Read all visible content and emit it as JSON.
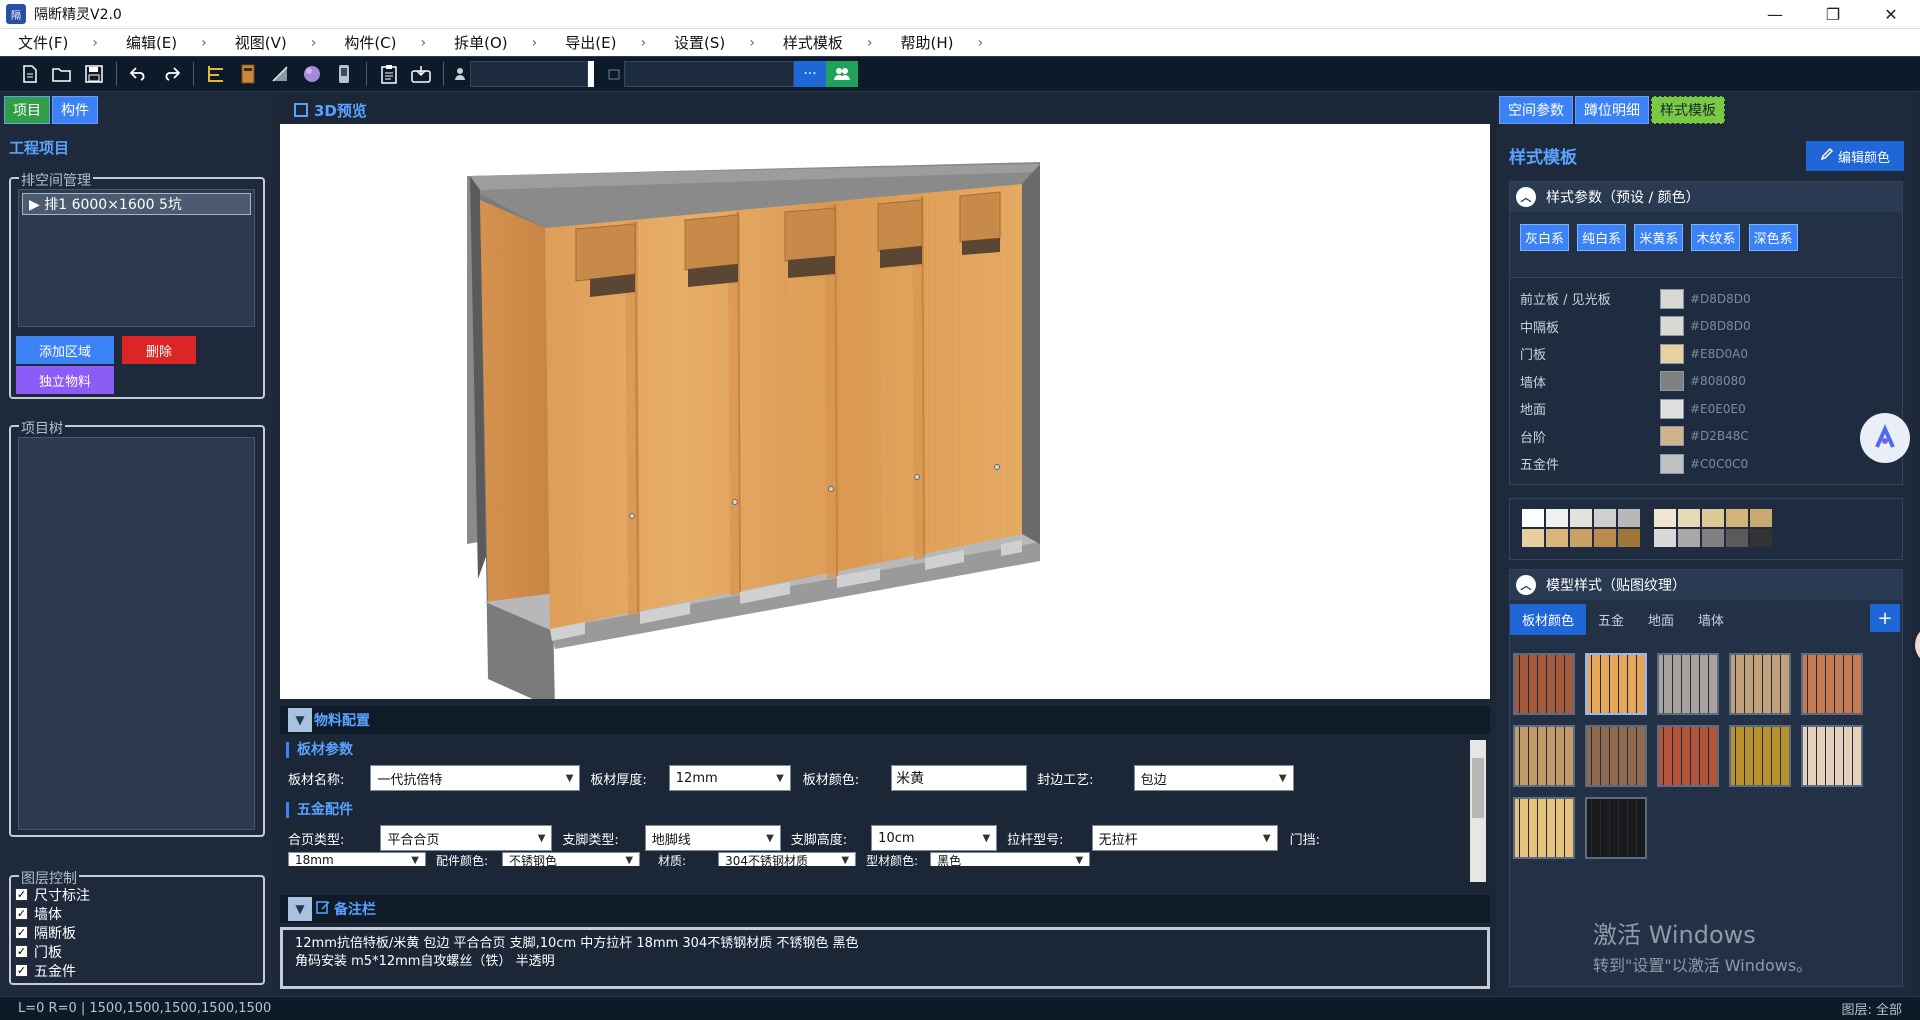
{
  "window": {
    "title": "隔断精灵V2.0",
    "app_icon": "隔",
    "controls": [
      "—",
      "❐",
      "✕"
    ]
  },
  "menu": {
    "items": [
      {
        "label": "文件(F)"
      },
      {
        "label": "编辑(E)"
      },
      {
        "label": "视图(V)"
      },
      {
        "label": "构件(C)"
      },
      {
        "label": "拆单(O)"
      },
      {
        "label": "导出(E)"
      },
      {
        "label": "设置(S)"
      },
      {
        "label": "样式模板"
      },
      {
        "label": "帮助(H)"
      }
    ],
    "separator": "›"
  },
  "toolbar": {
    "icons": [
      "new-file-icon",
      "open-folder-icon",
      "save-icon",
      "undo-icon",
      "redo-icon",
      "ruler-icon",
      "door-icon",
      "slash-panel-icon",
      "sphere-icon",
      "phone-icon",
      "clipboard-icon",
      "export-icon",
      "user-icon",
      "calendar-icon",
      "more-icon",
      "group-icon"
    ],
    "more_label": "···"
  },
  "left": {
    "tabs": [
      "项目",
      "构件"
    ],
    "section_title": "工程项目",
    "rows_group_label": "排空间管理",
    "rows": [
      {
        "label": "▶ 排1  6000×1600 5坑"
      }
    ],
    "add_area_btn": "添加区域",
    "delete_btn": "删除",
    "independent_material_btn": "独立物料",
    "tree_group_label": "项目树",
    "layers_group_label": "图层控制",
    "layers": [
      {
        "label": "尺寸标注",
        "checked": true
      },
      {
        "label": "墙体",
        "checked": true
      },
      {
        "label": "隔断板",
        "checked": true
      },
      {
        "label": "门板",
        "checked": true
      },
      {
        "label": "五金件",
        "checked": true
      }
    ]
  },
  "center": {
    "preview_title": "3D预览",
    "material_title": "物料配置",
    "board_params_title": "板材参数",
    "board": {
      "name_label": "板材名称:",
      "name_value": "一代抗倍特",
      "thickness_label": "板材厚度:",
      "thickness_value": "12mm",
      "color_label": "板材颜色:",
      "color_value": "米黄",
      "edge_label": "封边工艺:",
      "edge_value": "包边"
    },
    "hardware_title": "五金配件",
    "hardware": {
      "hinge_label": "合页类型:",
      "hinge_value": "平合合页",
      "foot_label": "支脚类型:",
      "foot_value": "地脚线",
      "foot_height_label": "支脚高度:",
      "foot_height_value": "10cm",
      "bar_label": "拉杆型号:",
      "bar_value": "无拉杆",
      "stop_label": "门挡:",
      "size_value": "18mm",
      "acc_color_label": "配件颜色:",
      "acc_color_value": "不锈钢色",
      "material_label": "材质:",
      "material_value": "304不锈钢材质",
      "profile_color_label": "型材颜色:",
      "profile_color_value": "黑色"
    },
    "notes_title": "备注栏",
    "notes_line1": "12mm抗倍特板/米黄   包边   平合合页   支脚,10cm   中方拉杆   18mm   304不锈钢材质   不锈钢色   黑色",
    "notes_line2": "角码安装   m5*12mm自攻螺丝（铁）   半透明"
  },
  "right": {
    "tabs": [
      "空间参数",
      "蹲位明细",
      "样式模板"
    ],
    "title": "样式模板",
    "edit_btn": "编辑颜色",
    "style_params_title": "样式参数（预设 / 颜色）",
    "presets": [
      "灰白系",
      "纯白系",
      "米黄系",
      "木纹系",
      "深色系"
    ],
    "colors": [
      {
        "name": "前立板 / 见光板",
        "hex": "#D8D8D0"
      },
      {
        "name": "中隔板",
        "hex": "#D8D8D0"
      },
      {
        "name": "门板",
        "hex": "#E8D0A0"
      },
      {
        "name": "墙体",
        "hex": "#808080"
      },
      {
        "name": "地面",
        "hex": "#E0E0E0"
      },
      {
        "name": "台阶",
        "hex": "#D2B48C"
      },
      {
        "name": "五金件",
        "hex": "#C0C0C0"
      }
    ],
    "palette": [
      "#ffffff",
      "#f1f1f1",
      "#e3e3de",
      "#cfcfcf",
      "#b8b8b8",
      "#efe6d2",
      "#e6d9b8",
      "#ddc995",
      "#cfb57a",
      "#c8a970",
      "#e8cf9f",
      "#d9b57a",
      "#c9a164",
      "#b88a4c",
      "#9f7538",
      "#d8d8d8",
      "#a8a8a8",
      "#808080",
      "#5a5a5a",
      "#333333"
    ],
    "model_style_title": "模型样式（贴图纹理）",
    "texture_tabs": [
      "板材颜色",
      "五金",
      "地面",
      "墙体"
    ],
    "add_label": "+",
    "textures": [
      "#a65a3c",
      "#e7a75a",
      "#a9a39c",
      "#c2a07a",
      "#c67a52",
      "#c39a6a",
      "#8f6a4c",
      "#b4553a",
      "#b8902c",
      "#e6d2bc",
      "#e6c27a",
      "#1a1a1a"
    ]
  },
  "watermark": {
    "line1": "激活 Windows",
    "line2": "转到\"设置\"以激活 Windows。"
  },
  "status": {
    "left": "L=0 R=0 | 1500,1500,1500,1500,1500",
    "right": "图层: 全部"
  }
}
